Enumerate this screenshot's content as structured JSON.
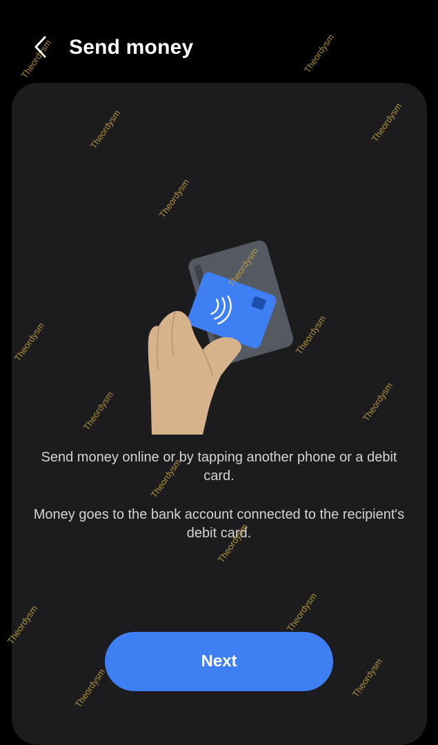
{
  "header": {
    "back_icon": "chevron-left-icon",
    "title": "Send money"
  },
  "main": {
    "illustration_icon": "hand-tapping-card-illustration",
    "description_1": "Send money online or by tapping another phone or a debit card.",
    "description_2": "Money goes to the bank account connected to the recipient's debit card.",
    "next_label": "Next"
  },
  "watermark": {
    "text": "Theordysm"
  },
  "colors": {
    "background": "#000000",
    "card": "#1c1c1e",
    "accent": "#3e7ff3",
    "text_secondary": "#d4d4d6"
  }
}
